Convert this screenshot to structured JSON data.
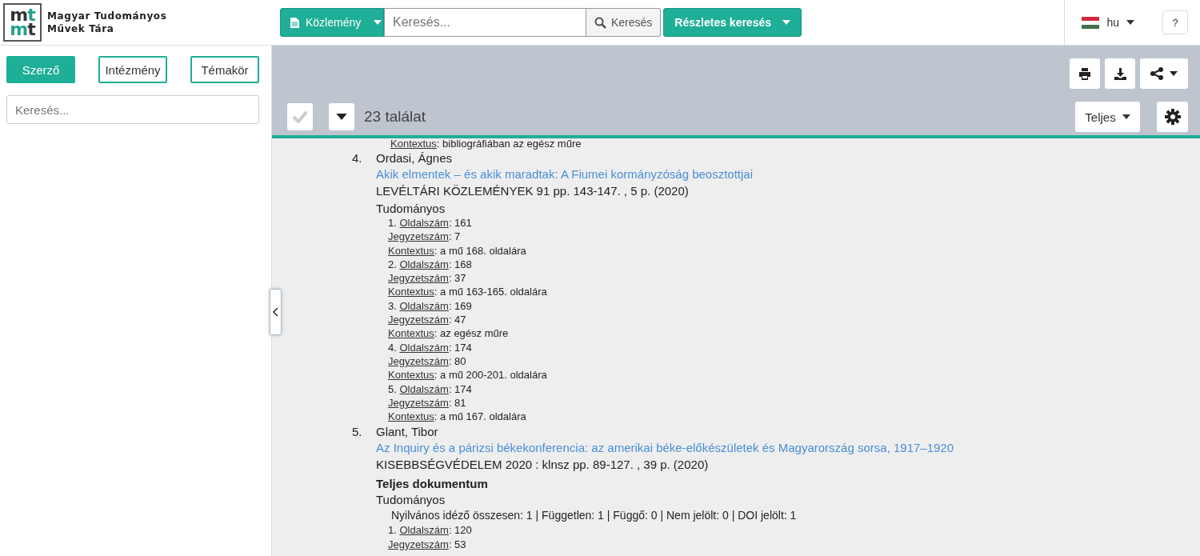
{
  "header": {
    "logo": {
      "mark_lines": [
        "mt",
        "mt"
      ],
      "name_lines": [
        "Magyar Tudományos",
        "Művek Tára"
      ]
    },
    "type_dropdown": "Közlemény",
    "search": {
      "placeholder": "Keresés..."
    },
    "search_button": "Keresés",
    "advanced_button": "Részletes keresés",
    "language": "hu",
    "help_button": "?"
  },
  "sidebar": {
    "tabs": [
      {
        "label": "Szerző",
        "selected": true
      },
      {
        "label": "Intézmény",
        "selected": false
      },
      {
        "label": "Témakör",
        "selected": false
      }
    ],
    "search": {
      "placeholder": "Keresés..."
    }
  },
  "toolbar": {
    "select_all_checked": false,
    "result_count": "23 találat",
    "view_dropdown": "Teljes"
  },
  "results": {
    "partial_line": {
      "label": "Kontextus",
      "value": ": bibliográfiában az egész műre"
    },
    "items": [
      {
        "number": "4.",
        "author": "Ordasi, Ágnes",
        "title": "Akik elmentek – és akik maradtak: A Fiumei kormányzóság beosztottjai",
        "source": "LEVÉLTÁRI KÖZLEMÉNYEK 91 pp. 143-147. , 5 p. (2020)",
        "category": "Tudományos",
        "citations": [
          {
            "number": "1.",
            "fields": [
              {
                "label": "Oldalszám",
                "value": ": 161"
              },
              {
                "label": "Jegyzetszám",
                "value": ": 7"
              },
              {
                "label": "Kontextus",
                "value": ": a mű 168. oldalára"
              }
            ]
          },
          {
            "number": "2.",
            "fields": [
              {
                "label": "Oldalszám",
                "value": ": 168"
              },
              {
                "label": "Jegyzetszám",
                "value": ": 37"
              },
              {
                "label": "Kontextus",
                "value": ": a mű 163-165. oldalára"
              }
            ]
          },
          {
            "number": "3.",
            "fields": [
              {
                "label": "Oldalszám",
                "value": ": 169"
              },
              {
                "label": "Jegyzetszám",
                "value": ": 47"
              },
              {
                "label": "Kontextus",
                "value": ": az egész műre"
              }
            ]
          },
          {
            "number": "4.",
            "fields": [
              {
                "label": "Oldalszám",
                "value": ": 174"
              },
              {
                "label": "Jegyzetszám",
                "value": ": 80"
              },
              {
                "label": "Kontextus",
                "value": ": a mű 200-201. oldalára"
              }
            ]
          },
          {
            "number": "5.",
            "fields": [
              {
                "label": "Oldalszám",
                "value": ": 174"
              },
              {
                "label": "Jegyzetszám",
                "value": ": 81"
              },
              {
                "label": "Kontextus",
                "value": ": a mű 167. oldalára"
              }
            ]
          }
        ]
      },
      {
        "number": "5.",
        "author": "Glant, Tibor",
        "title": "Az Inquiry és a párizsi békekonferencia: az amerikai béke-előkészületek és Magyarország sorsa, 1917–1920",
        "source": "KISEBBSÉGVÉDELEM 2020 : klnsz pp. 89-127. , 39 p. (2020)",
        "full_document": "Teljes dokumentum",
        "category": "Tudományos",
        "summary": "Nyilvános idéző összesen: 1 | Független: 1 | Függő: 0 | Nem jelölt: 0 | DOI jelölt: 1",
        "citations": [
          {
            "number": "1.",
            "fields": [
              {
                "label": "Oldalszám",
                "value": ": 120"
              },
              {
                "label": "Jegyzetszám",
                "value": ": 53"
              }
            ]
          }
        ]
      }
    ]
  }
}
